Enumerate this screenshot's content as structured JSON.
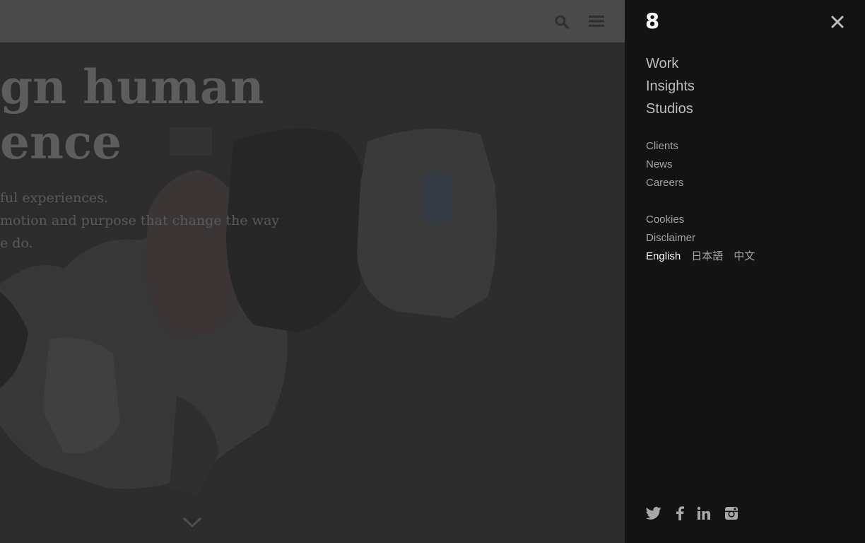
{
  "page": {
    "headline_line1": "gn human",
    "headline_line2": "ence",
    "copy_line1": "ful experiences.",
    "copy_line2": "motion and purpose that change the way",
    "copy_line3": "e do."
  },
  "nav": {
    "logo": "8",
    "primary": [
      "Work",
      "Insights",
      "Studios"
    ],
    "secondary": [
      "Clients",
      "News",
      "Careers"
    ],
    "legal": [
      "Cookies",
      "Disclaimer"
    ],
    "languages": [
      "English",
      "日本語",
      "中文"
    ],
    "active_language": "English",
    "social": [
      "twitter-icon",
      "facebook-icon",
      "linkedin-icon",
      "instagram-icon"
    ]
  },
  "colors": {
    "panel_bg": "#131313",
    "page_overlay": "#2c2c2c",
    "topbar_bg": "#4a4a4a",
    "nav_text": "#bdbdbd",
    "active_text": "#ffffff"
  }
}
